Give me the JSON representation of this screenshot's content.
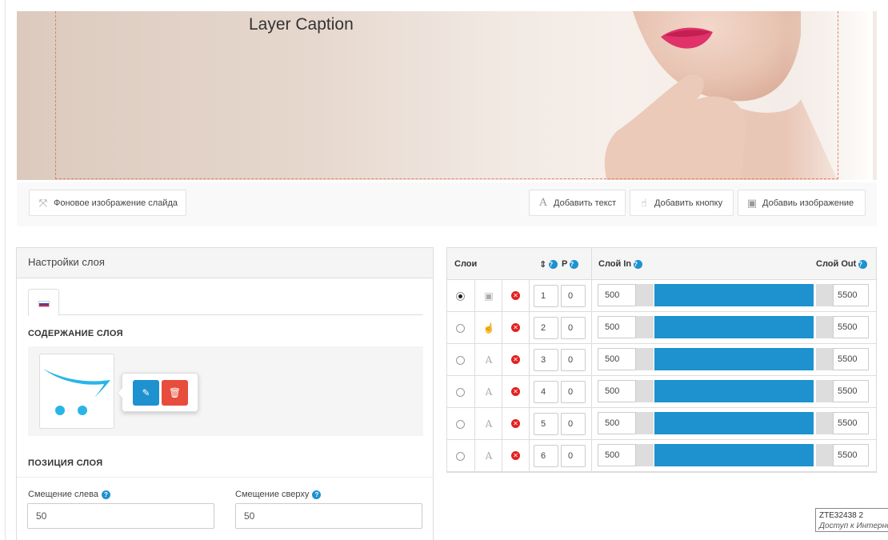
{
  "slide": {
    "caption": "Layer Caption"
  },
  "toolbar": {
    "background_label": "Фоновое изображение слайда",
    "add_text_label": "Добавить текст",
    "add_button_label": "Добавить кнопку",
    "add_image_label": "Добавиь изображение"
  },
  "layer_settings": {
    "title": "Настройки слоя",
    "content_title": "СОДЕРЖАНИЕ СЛОЯ",
    "position_title": "ПОЗИЦИЯ СЛОЯ",
    "offset_left_label": "Смещение слева",
    "offset_left_value": "50",
    "offset_top_label": "Смещение сверху",
    "offset_top_value": "50"
  },
  "layers_table": {
    "col_layers": "Слои",
    "col_p": "P",
    "col_in": "Слой In",
    "col_out": "Слой Out",
    "rows": [
      {
        "selected": true,
        "type": "image-icon",
        "order": "1",
        "p": "0",
        "in": "500",
        "out": "5500"
      },
      {
        "selected": false,
        "type": "hand-pointer-icon",
        "order": "2",
        "p": "0",
        "in": "500",
        "out": "5500"
      },
      {
        "selected": false,
        "type": "text-icon",
        "order": "3",
        "p": "0",
        "in": "500",
        "out": "5500"
      },
      {
        "selected": false,
        "type": "text-icon",
        "order": "4",
        "p": "0",
        "in": "500",
        "out": "5500"
      },
      {
        "selected": false,
        "type": "text-icon",
        "order": "5",
        "p": "0",
        "in": "500",
        "out": "5500"
      },
      {
        "selected": false,
        "type": "text-icon",
        "order": "6",
        "p": "0",
        "in": "500",
        "out": "5500"
      }
    ]
  },
  "tooltip": {
    "line1": "ZTE32438  2",
    "line2": "Доступ к Интерне"
  },
  "colors": {
    "accent_blue": "#1e91cf",
    "danger_red": "#e0211f",
    "delete_button": "#e84c3d",
    "edit_button": "#1e91cf"
  }
}
